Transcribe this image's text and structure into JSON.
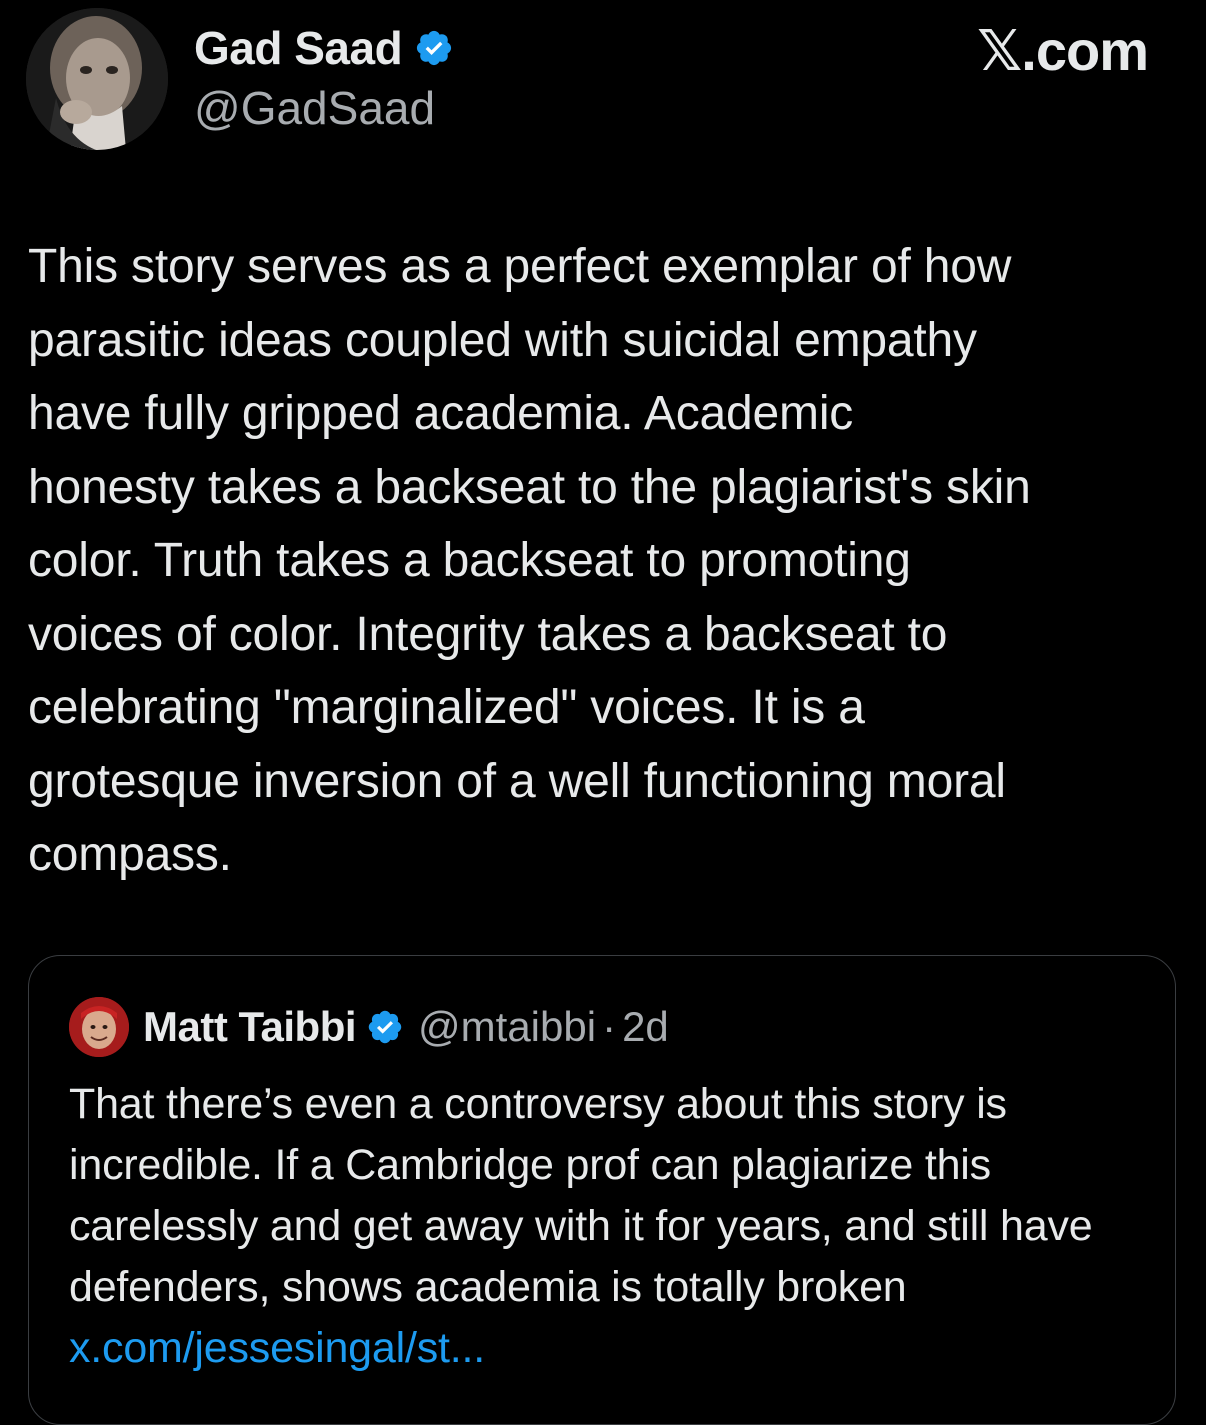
{
  "brand": {
    "logo_text": "𝕏.com"
  },
  "author": {
    "display_name": "Gad Saad",
    "handle": "@GadSaad",
    "verified": true
  },
  "tweet": {
    "text": "This story serves as a perfect exemplar of how\nparasitic ideas coupled with suicidal empathy\nhave fully gripped academia.  Academic\nhonesty takes a backseat to the plagiarist's skin\ncolor.  Truth takes a backseat to promoting\nvoices of color.  Integrity takes a backseat to\ncelebrating \"marginalized\" voices.  It is a\ngrotesque inversion of a well functioning moral\ncompass."
  },
  "quoted_tweet": {
    "display_name": "Matt Taibbi",
    "handle": "@mtaibbi",
    "separator": "·",
    "time": "2d",
    "verified": true,
    "text": "That there’s even a controversy about this story is incredible. If a Cambridge prof can plagiarize this carelessly and get away with it for years, and still have defenders, shows academia is totally broken ",
    "link_text": "x.com/jessesingal/st..."
  },
  "colors": {
    "background": "#000000",
    "text_primary": "#e7e9ea",
    "text_secondary": "#a8acb0",
    "link": "#1d9bf0",
    "verified_badge": "#1d9bf0",
    "card_border": "#3a3d41"
  },
  "icons": {
    "verified": "verified-badge-icon"
  }
}
